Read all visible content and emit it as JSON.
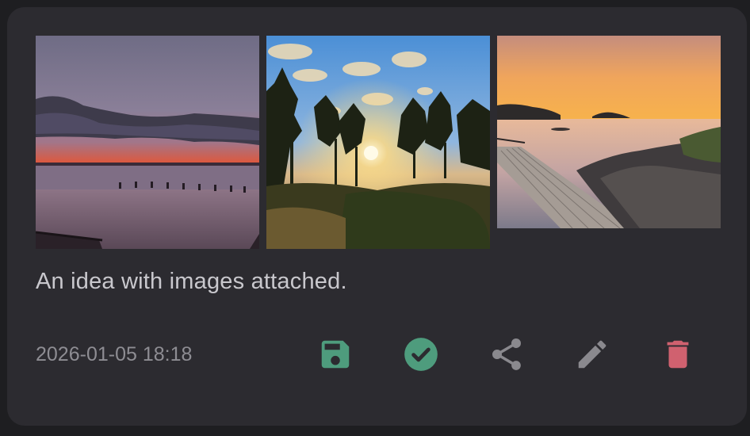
{
  "note": {
    "text": "An idea with images attached.",
    "timestamp": "2026-01-05 18:18",
    "images": [
      {
        "description": "sunset-over-sea-with-jetty"
      },
      {
        "description": "sun-through-pine-trees"
      },
      {
        "description": "sunset-over-calm-lake-with-pier"
      }
    ]
  },
  "actions": [
    {
      "icon": "save-icon",
      "color": "#4e9c7d"
    },
    {
      "icon": "check-circle-icon",
      "color": "#4e9c7d"
    },
    {
      "icon": "share-icon",
      "color": "#8a898e"
    },
    {
      "icon": "pencil-icon",
      "color": "#8a898e"
    },
    {
      "icon": "trash-icon",
      "color": "#d0616f"
    }
  ],
  "colors": {
    "background": "#1e1e21",
    "card": "#2c2b30",
    "text_primary": "#c9c8cd",
    "text_secondary": "#8e8d93"
  }
}
